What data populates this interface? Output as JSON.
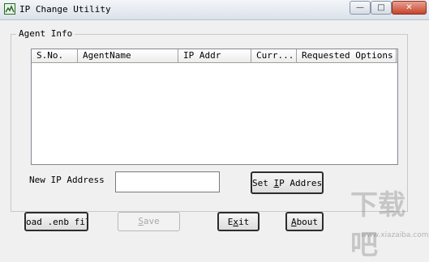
{
  "window": {
    "title": "IP Change Utility",
    "minimize_glyph": "—",
    "maximize_glyph": "□",
    "close_glyph": "✕"
  },
  "agent_info": {
    "group_label": "Agent Info",
    "columns": [
      "S.No.",
      "AgentName",
      "IP Addr",
      "Curr...",
      "Requested Options"
    ],
    "rows": []
  },
  "new_ip": {
    "label": "New IP Address",
    "value": ""
  },
  "buttons": {
    "set_ip_pre": "Set ",
    "set_ip_accel": "I",
    "set_ip_post": "P Address",
    "load": "oad .enb fil",
    "save_accel": "S",
    "save_post": "ave",
    "exit_pre": "E",
    "exit_accel": "x",
    "exit_post": "it",
    "about_accel": "A",
    "about_post": "bout"
  },
  "watermark": {
    "text": "下载吧",
    "url": "www.xiazaiba.com"
  },
  "colors": {
    "window_bg": "#f0f0f0",
    "close_button": "#c5452c",
    "disabled_text": "#a8a8a8"
  }
}
